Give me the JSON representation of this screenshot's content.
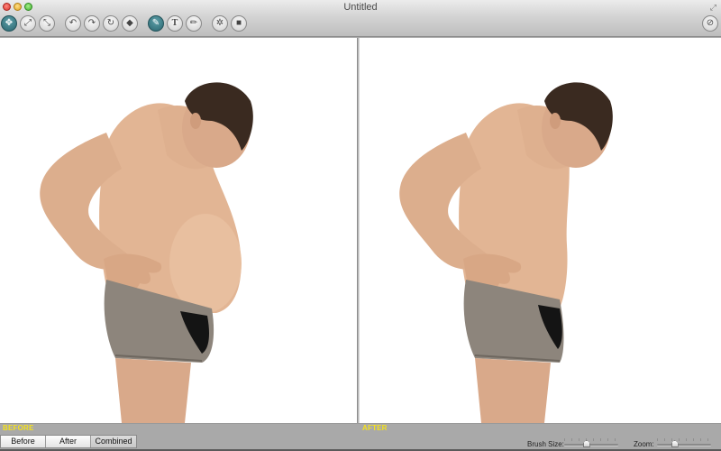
{
  "window": {
    "title": "Untitled",
    "controls": [
      "close",
      "minimize",
      "zoom"
    ]
  },
  "toolbar": {
    "tools": [
      {
        "name": "move-tool",
        "icon": "move-icon",
        "glyph": "✥",
        "active": true
      },
      {
        "name": "fit-to-screen",
        "icon": "expand-icon",
        "glyph": "⤢",
        "active": false
      },
      {
        "name": "actual-size",
        "icon": "collapse-icon",
        "glyph": "⤡",
        "active": false
      },
      {
        "name": "undo",
        "icon": "undo-icon",
        "glyph": "↶",
        "active": false
      },
      {
        "name": "redo",
        "icon": "redo-icon",
        "glyph": "↷",
        "active": false
      },
      {
        "name": "reset",
        "icon": "reset-icon",
        "glyph": "↻",
        "active": false
      },
      {
        "name": "eraser",
        "icon": "eraser-icon",
        "glyph": "◆",
        "active": false
      },
      {
        "name": "smooth-brush",
        "icon": "brush-icon",
        "glyph": "✎",
        "active": true
      },
      {
        "name": "text-tool",
        "icon": "text-icon",
        "glyph": "T",
        "active": false
      },
      {
        "name": "pencil-tool",
        "icon": "pencil-icon",
        "glyph": "✏",
        "active": false
      },
      {
        "name": "settings",
        "icon": "settings-icon",
        "glyph": "✲",
        "active": false
      },
      {
        "name": "video",
        "icon": "camera-icon",
        "glyph": "■",
        "active": false
      }
    ],
    "right_tool": {
      "name": "before-after-toggle",
      "icon": "toggle-icon",
      "glyph": "⊘"
    }
  },
  "panels": {
    "left": {
      "label": "BEFORE",
      "image_alt": "Shirtless man in gray underwear, side profile, before edit"
    },
    "right": {
      "label": "AFTER",
      "image_alt": "Shirtless man in gray underwear, side profile, after slimming edit"
    }
  },
  "view_modes": {
    "options": [
      "Before",
      "After",
      "Combined"
    ],
    "selected": "Combined"
  },
  "sliders": {
    "brush_size": {
      "label": "Brush Size:",
      "value": 0.4
    },
    "zoom": {
      "label": "Zoom:",
      "value": 0.3
    }
  },
  "colors": {
    "panel_label": "#f5e11d",
    "active_tool": "#2a6670",
    "skin": "#e2b594",
    "underwear": "#8d857c"
  }
}
